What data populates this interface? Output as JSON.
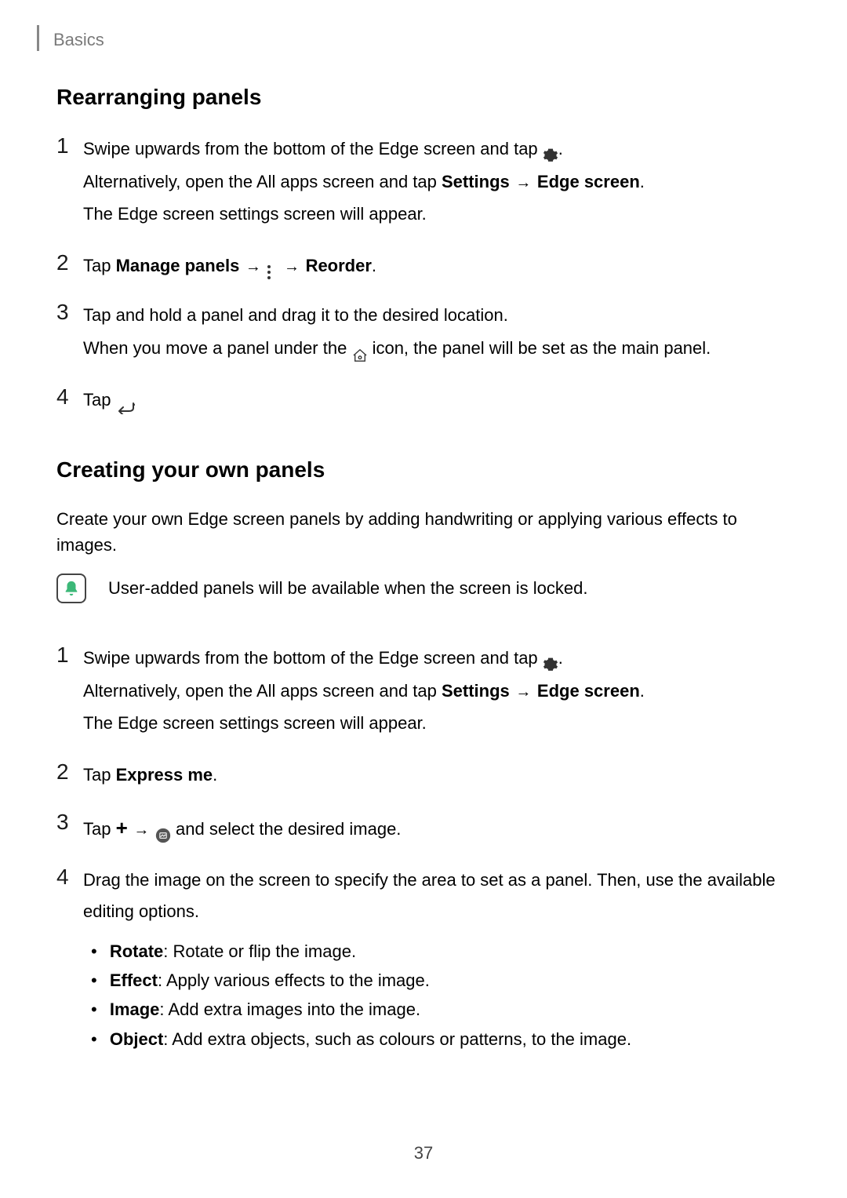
{
  "header": {
    "category": "Basics"
  },
  "sections": {
    "rearranging": {
      "title": "Rearranging panels",
      "steps": {
        "s1": {
          "num": "1",
          "line1a": "Swipe upwards from the bottom of the Edge screen and tap ",
          "line1b": ".",
          "line2a": "Alternatively, open the All apps screen and tap ",
          "settings": "Settings",
          "arrow1": " → ",
          "edgescreen": "Edge screen",
          "line2b": ".",
          "line3": "The Edge screen settings screen will appear."
        },
        "s2": {
          "num": "2",
          "tap": "Tap ",
          "managepanels": "Manage panels",
          "arrow1": " → ",
          "arrow2": " → ",
          "reorder": "Reorder",
          "period": "."
        },
        "s3": {
          "num": "3",
          "line1": "Tap and hold a panel and drag it to the desired location.",
          "line2a": "When you move a panel under the ",
          "line2b": " icon, the panel will be set as the main panel."
        },
        "s4": {
          "num": "4",
          "tap": "Tap ",
          "period": "."
        }
      }
    },
    "creating": {
      "title": "Creating your own panels",
      "intro": "Create your own Edge screen panels by adding handwriting or applying various effects to images.",
      "note": "User-added panels will be available when the screen is locked.",
      "steps": {
        "s1": {
          "num": "1",
          "line1a": "Swipe upwards from the bottom of the Edge screen and tap ",
          "line1b": ".",
          "line2a": "Alternatively, open the All apps screen and tap ",
          "settings": "Settings",
          "arrow1": " → ",
          "edgescreen": "Edge screen",
          "line2b": ".",
          "line3": "The Edge screen settings screen will appear."
        },
        "s2": {
          "num": "2",
          "tap": "Tap ",
          "expressme": "Express me",
          "period": "."
        },
        "s3": {
          "num": "3",
          "tap": "Tap ",
          "arrow": " → ",
          "rest": " and select the desired image."
        },
        "s4": {
          "num": "4",
          "text": "Drag the image on the screen to specify the area to set as a panel. Then, use the available editing options.",
          "bullets": {
            "b1": {
              "label": "Rotate",
              "text": ": Rotate or flip the image."
            },
            "b2": {
              "label": "Effect",
              "text": ": Apply various effects to the image."
            },
            "b3": {
              "label": "Image",
              "text": ": Add extra images into the image."
            },
            "b4": {
              "label": "Object",
              "text": ": Add extra objects, such as colours or patterns, to the image."
            }
          }
        }
      }
    }
  },
  "pageNumber": "37"
}
